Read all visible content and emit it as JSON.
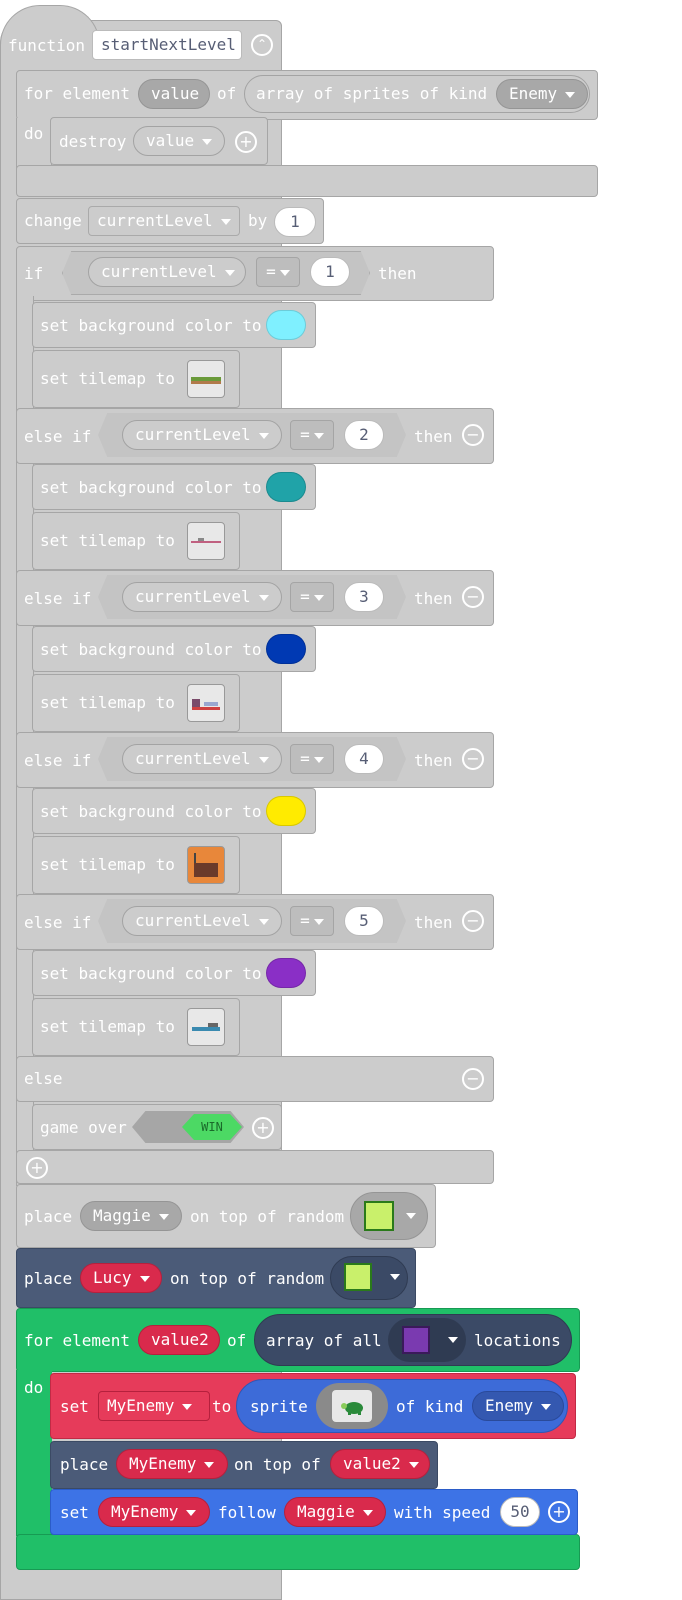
{
  "function": {
    "keyword": "function",
    "name": "startNextLevel"
  },
  "for_loop": {
    "for_label": "for element",
    "var": "value",
    "of_label": "of",
    "array_label": "array of sprites of kind",
    "kind": "Enemy",
    "do_label": "do",
    "destroy_label": "destroy",
    "destroy_var": "value"
  },
  "change": {
    "label": "change",
    "var": "currentLevel",
    "by_label": "by",
    "amount": "1"
  },
  "conditions": {
    "if_label": "if",
    "else_if_label": "else if",
    "then_label": "then",
    "else_label": "else",
    "var": "currentLevel",
    "op": "=",
    "set_bg_label": "set background color to",
    "set_tilemap_label": "set tilemap to",
    "branches": [
      {
        "value": "1",
        "color": "#7ff0ff"
      },
      {
        "value": "2",
        "color": "#20a3a8"
      },
      {
        "value": "3",
        "color": "#0039b3"
      },
      {
        "value": "4",
        "color": "#ffeb00"
      },
      {
        "value": "5",
        "color": "#8a2fc6"
      }
    ],
    "game_over_label": "game over",
    "win_label": "WIN"
  },
  "place1": {
    "label": "place",
    "sprite": "Maggie",
    "on_top_label": "on top of random"
  },
  "place2": {
    "label": "place",
    "sprite": "Lucy",
    "on_top_label": "on top of random"
  },
  "for2": {
    "for_label": "for element",
    "var": "value2",
    "of_label": "of",
    "array_label": "array of all",
    "locations_label": "locations",
    "do_label": "do"
  },
  "set_sprite": {
    "label": "set",
    "var": "MyEnemy",
    "to_label": "to",
    "sprite_label": "sprite",
    "of_kind_label": "of kind",
    "kind": "Enemy"
  },
  "place3": {
    "label": "place",
    "sprite": "MyEnemy",
    "on_top_label": "on top of",
    "target": "value2"
  },
  "follow": {
    "label": "set",
    "sprite": "MyEnemy",
    "follow_label": "follow",
    "target": "Maggie",
    "speed_label": "with speed",
    "speed": "50"
  },
  "colors": {
    "gray_block": "#cccccc",
    "slate_block": "#4b5b78",
    "green_block": "#20bf68",
    "red_block": "#e63b5a",
    "blue_block": "#3d73e6"
  },
  "icons": [
    "expand-collapse-icon",
    "add-icon",
    "remove-icon",
    "flag-icon",
    "location-icon",
    "turtle-sprite-icon"
  ]
}
